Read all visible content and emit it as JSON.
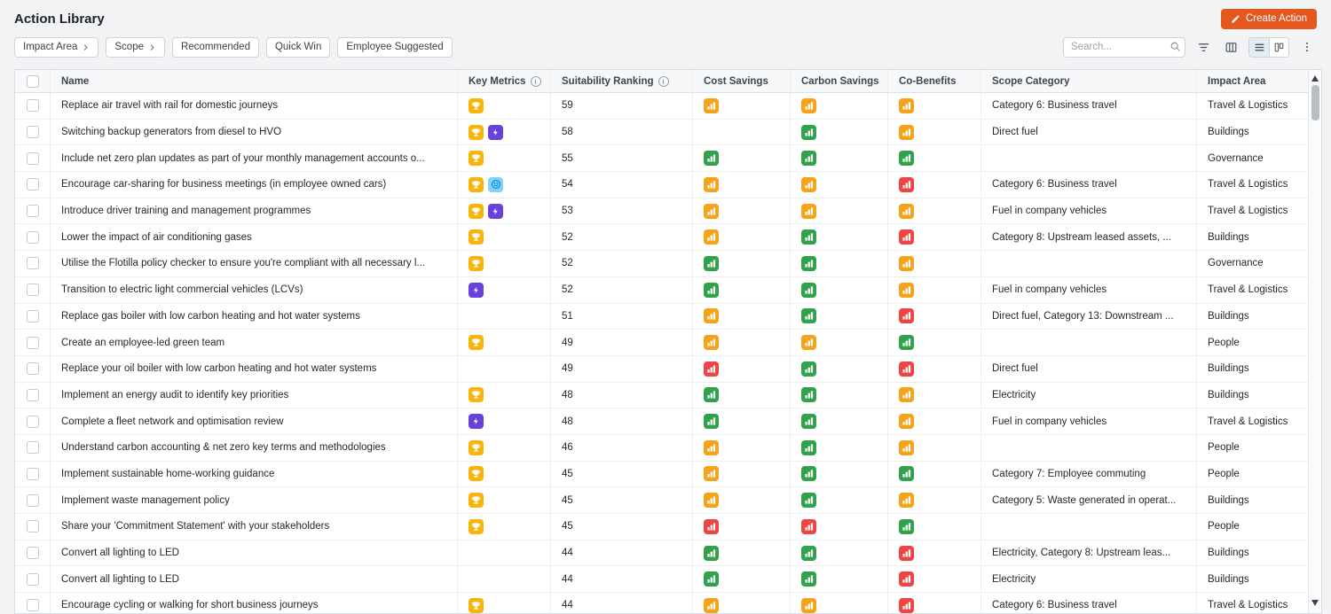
{
  "header": {
    "title": "Action Library",
    "create_button": "Create Action"
  },
  "filters": {
    "impact_area": "Impact Area",
    "scope": "Scope",
    "recommended": "Recommended",
    "quick_win": "Quick Win",
    "employee_suggested": "Employee Suggested",
    "search_placeholder": "Search..."
  },
  "view_toggle": {
    "active": "list"
  },
  "colors": {
    "accent": "#e4571e",
    "amber": "#f5a31b",
    "green": "#31a24c",
    "red": "#f04444",
    "trophy_bg": "#f7b50c",
    "lightning_bg": "#6741d9",
    "smiley_bg": "#7fd4fb"
  },
  "table": {
    "columns": [
      "Name",
      "Key Metrics",
      "Suitability Ranking",
      "Cost Savings",
      "Carbon Savings",
      "Co-Benefits",
      "Scope Category",
      "Impact Area"
    ],
    "rows": [
      {
        "name": "Replace air travel with rail for domestic journeys",
        "key_metrics": [
          "trophy"
        ],
        "ranking": "59",
        "cost_savings": "amber",
        "carbon_savings": "amber",
        "co_benefits": "amber",
        "scope_category": "Category 6: Business travel",
        "impact_area": "Travel & Logistics"
      },
      {
        "name": "Switching backup generators from diesel to HVO",
        "key_metrics": [
          "trophy",
          "lightning"
        ],
        "ranking": "58",
        "cost_savings": "",
        "carbon_savings": "green",
        "co_benefits": "amber",
        "scope_category": "Direct fuel",
        "impact_area": "Buildings"
      },
      {
        "name": "Include net zero plan updates as part of your monthly management accounts o...",
        "key_metrics": [
          "trophy"
        ],
        "ranking": "55",
        "cost_savings": "green",
        "carbon_savings": "green",
        "co_benefits": "green",
        "scope_category": "",
        "impact_area": "Governance"
      },
      {
        "name": "Encourage car-sharing for business meetings (in employee owned cars)",
        "key_metrics": [
          "trophy",
          "smiley"
        ],
        "ranking": "54",
        "cost_savings": "amber",
        "carbon_savings": "amber",
        "co_benefits": "red",
        "scope_category": "Category 6: Business travel",
        "impact_area": "Travel & Logistics"
      },
      {
        "name": "Introduce driver training and management programmes",
        "key_metrics": [
          "trophy",
          "lightning"
        ],
        "ranking": "53",
        "cost_savings": "amber",
        "carbon_savings": "amber",
        "co_benefits": "amber",
        "scope_category": "Fuel in company vehicles",
        "impact_area": "Travel & Logistics"
      },
      {
        "name": "Lower the impact of air conditioning gases",
        "key_metrics": [
          "trophy"
        ],
        "ranking": "52",
        "cost_savings": "amber",
        "carbon_savings": "green",
        "co_benefits": "red",
        "scope_category": "Category 8: Upstream leased assets, ...",
        "impact_area": "Buildings"
      },
      {
        "name": "Utilise the Flotilla policy checker to ensure you're compliant with all necessary l...",
        "key_metrics": [
          "trophy"
        ],
        "ranking": "52",
        "cost_savings": "green",
        "carbon_savings": "green",
        "co_benefits": "amber",
        "scope_category": "",
        "impact_area": "Governance"
      },
      {
        "name": "Transition to electric light commercial vehicles (LCVs)",
        "key_metrics": [
          "lightning"
        ],
        "ranking": "52",
        "cost_savings": "green",
        "carbon_savings": "green",
        "co_benefits": "amber",
        "scope_category": "Fuel in company vehicles",
        "impact_area": "Travel & Logistics"
      },
      {
        "name": "Replace gas boiler with low carbon heating and hot water systems",
        "key_metrics": [],
        "ranking": "51",
        "cost_savings": "amber",
        "carbon_savings": "green",
        "co_benefits": "red",
        "scope_category": "Direct fuel, Category 13: Downstream ...",
        "impact_area": "Buildings"
      },
      {
        "name": "Create an employee-led green team",
        "key_metrics": [
          "trophy"
        ],
        "ranking": "49",
        "cost_savings": "amber",
        "carbon_savings": "amber",
        "co_benefits": "green",
        "scope_category": "",
        "impact_area": "People"
      },
      {
        "name": "Replace your oil boiler with low carbon heating and hot water systems",
        "key_metrics": [],
        "ranking": "49",
        "cost_savings": "red",
        "carbon_savings": "green",
        "co_benefits": "red",
        "scope_category": "Direct fuel",
        "impact_area": "Buildings"
      },
      {
        "name": "Implement an energy audit to identify key priorities",
        "key_metrics": [
          "trophy"
        ],
        "ranking": "48",
        "cost_savings": "green",
        "carbon_savings": "green",
        "co_benefits": "amber",
        "scope_category": "Electricity",
        "impact_area": "Buildings"
      },
      {
        "name": "Complete a fleet network and optimisation review",
        "key_metrics": [
          "lightning"
        ],
        "ranking": "48",
        "cost_savings": "green",
        "carbon_savings": "green",
        "co_benefits": "amber",
        "scope_category": "Fuel in company vehicles",
        "impact_area": "Travel & Logistics"
      },
      {
        "name": "Understand carbon accounting & net zero key terms and methodologies",
        "key_metrics": [
          "trophy"
        ],
        "ranking": "46",
        "cost_savings": "amber",
        "carbon_savings": "green",
        "co_benefits": "amber",
        "scope_category": "",
        "impact_area": "People"
      },
      {
        "name": "Implement sustainable home-working guidance",
        "key_metrics": [
          "trophy"
        ],
        "ranking": "45",
        "cost_savings": "amber",
        "carbon_savings": "green",
        "co_benefits": "green",
        "scope_category": "Category 7: Employee commuting",
        "impact_area": "People"
      },
      {
        "name": "Implement waste management policy",
        "key_metrics": [
          "trophy"
        ],
        "ranking": "45",
        "cost_savings": "amber",
        "carbon_savings": "green",
        "co_benefits": "amber",
        "scope_category": "Category 5: Waste generated in operat...",
        "impact_area": "Buildings"
      },
      {
        "name": "Share your 'Commitment Statement' with your stakeholders",
        "key_metrics": [
          "trophy"
        ],
        "ranking": "45",
        "cost_savings": "red",
        "carbon_savings": "red",
        "co_benefits": "green",
        "scope_category": "",
        "impact_area": "People"
      },
      {
        "name": "Convert all lighting to LED",
        "key_metrics": [],
        "ranking": "44",
        "cost_savings": "green",
        "carbon_savings": "green",
        "co_benefits": "red",
        "scope_category": "Electricity, Category 8: Upstream leas...",
        "impact_area": "Buildings"
      },
      {
        "name": "Convert all lighting to LED",
        "key_metrics": [],
        "ranking": "44",
        "cost_savings": "green",
        "carbon_savings": "green",
        "co_benefits": "red",
        "scope_category": "Electricity",
        "impact_area": "Buildings"
      },
      {
        "name": "Encourage cycling or walking for short business journeys",
        "key_metrics": [
          "trophy"
        ],
        "ranking": "44",
        "cost_savings": "amber",
        "carbon_savings": "amber",
        "co_benefits": "red",
        "scope_category": "Category 6: Business travel",
        "impact_area": "Travel & Logistics"
      }
    ]
  }
}
